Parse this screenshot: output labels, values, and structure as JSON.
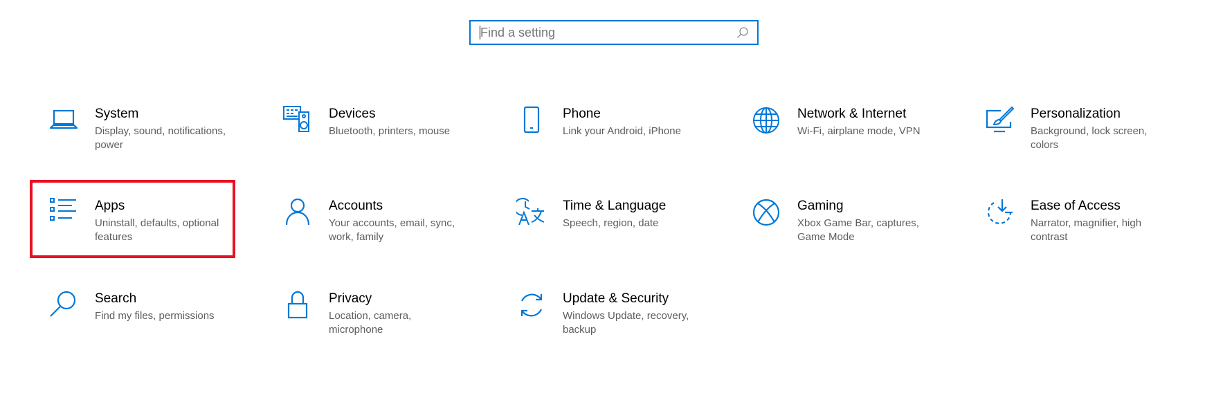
{
  "search": {
    "placeholder": "Find a setting"
  },
  "colors": {
    "accent": "#0078d7",
    "highlight": "#e81123"
  },
  "tiles": [
    {
      "title": "System",
      "description": "Display, sound, notifications, power",
      "icon": "laptop-icon"
    },
    {
      "title": "Devices",
      "description": "Bluetooth, printers, mouse",
      "icon": "devices-icon"
    },
    {
      "title": "Phone",
      "description": "Link your Android, iPhone",
      "icon": "phone-icon"
    },
    {
      "title": "Network & Internet",
      "description": "Wi-Fi, airplane mode, VPN",
      "icon": "globe-icon"
    },
    {
      "title": "Personalization",
      "description": "Background, lock screen, colors",
      "icon": "paint-icon"
    },
    {
      "title": "Apps",
      "description": "Uninstall, defaults, optional features",
      "icon": "apps-list-icon"
    },
    {
      "title": "Accounts",
      "description": "Your accounts, email, sync, work, family",
      "icon": "person-icon"
    },
    {
      "title": "Time & Language",
      "description": "Speech, region, date",
      "icon": "time-language-icon"
    },
    {
      "title": "Gaming",
      "description": "Xbox Game Bar, captures, Game Mode",
      "icon": "xbox-icon"
    },
    {
      "title": "Ease of Access",
      "description": "Narrator, magnifier, high contrast",
      "icon": "ease-of-access-icon"
    },
    {
      "title": "Search",
      "description": "Find my files, permissions",
      "icon": "search-icon"
    },
    {
      "title": "Privacy",
      "description": "Location, camera, microphone",
      "icon": "lock-icon"
    },
    {
      "title": "Update & Security",
      "description": "Windows Update, recovery, backup",
      "icon": "sync-icon"
    }
  ]
}
